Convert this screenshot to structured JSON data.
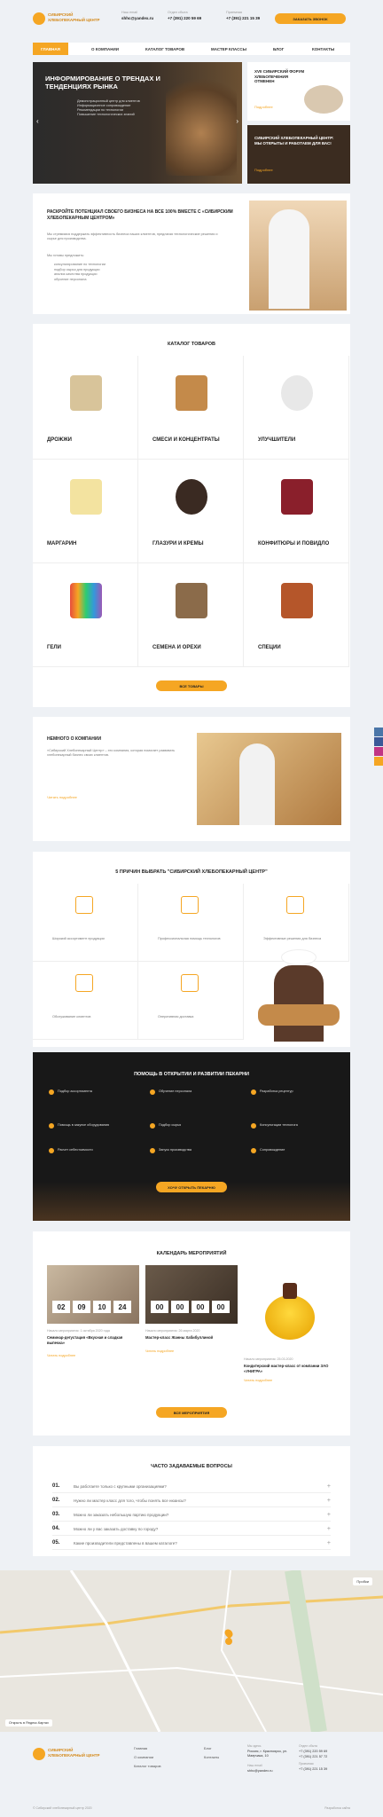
{
  "header": {
    "logo_text": "СИБИРСКИЙ ХЛЕБОПЕКАРНЫЙ ЦЕНТР",
    "email_label": "Наш email",
    "email": "shhc@yandex.ru",
    "sales_label": "Отдел сбыта",
    "sales_phone": "+7 (391) 220 59 69",
    "phone2_label": "Приемная",
    "phone2": "+7 (391) 221 15 39",
    "callback": "ЗАКАЗАТЬ ЗВОНОК"
  },
  "nav": [
    "ГЛАВНАЯ",
    "О КОМПАНИИ",
    "КАТАЛОГ ТОВАРОВ",
    "МАСТЕР КЛАССЫ",
    "БЛОГ",
    "КОНТАКТЫ"
  ],
  "hero": {
    "title": "ИНФОРМИРОВАНИЕ О ТРЕНДАХ И ТЕНДЕНЦИЯХ РЫНКА",
    "bullets": [
      "Демонстрационный центр для клиентов",
      "Информационное сопровождение",
      "Рекомендации по технологии",
      "Повышение технологических знаний"
    ],
    "side1_title": "XVII СИБИРСКИЙ ФОРУМ ХЛЕБОПЕЧЕНИЯ ОТМЕНЕН",
    "side1_link": "Подробнее",
    "side2_title": "СИБИРСКИЙ ХЛЕБОПЕКАРНЫЙ ЦЕНТР: МЫ ОТКРЫТЫ И РАБОТАЕМ ДЛЯ ВАС!",
    "side2_link": "Подробнее"
  },
  "promo": {
    "title": "РАСКРОЙТЕ ПОТЕНЦИАЛ СВОЕГО БИЗНЕСА НА ВСЕ 100% ВМЕСТЕ С «СИБИРСКИМ ХЛЕБОПЕКАРНЫМ ЦЕНТРОМ»",
    "p1": "Мы стремимся поддержать эффективность бизнеса наших клиентов, предлагая технологические решения и сырье для производства.",
    "p2": "Мы готовы предложить:",
    "items": [
      "консультирование по технологии",
      "подбор сырья для продукции",
      "анализ качества продукции",
      "обучение персонала"
    ]
  },
  "catalog": {
    "title": "КАТАЛОГ ТОВАРОВ",
    "items": [
      "ДРОЖЖИ",
      "СМЕСИ И КОНЦЕНТРАТЫ",
      "УЛУЧШИТЕЛИ",
      "МАРГАРИН",
      "ГЛАЗУРИ И КРЕМЫ",
      "КОНФИТЮРЫ И ПОВИДЛО",
      "ГЕЛИ",
      "СЕМЕНА И ОРЕХИ",
      "СПЕЦИИ"
    ],
    "button": "ВСЕ ТОВАРЫ"
  },
  "about": {
    "title": "НЕМНОГО О КОМПАНИИ",
    "text": "«Сибирский Хлебопекарный Центр» – это компания, которая помогает развивать хлебопекарный бизнес своих клиентов.",
    "link": "Читать подробнее"
  },
  "reasons": {
    "title": "5 ПРИЧИН ВЫБРАТЬ \"СИБИРСКИЙ ХЛЕБОПЕКАРНЫЙ ЦЕНТР\"",
    "items": [
      "Широкий ассортимент продукции",
      "Профессиональная помощь технологов",
      "Эффективные решения для бизнеса",
      "Обслуживание клиентов",
      "Оперативная доставка"
    ]
  },
  "help": {
    "title": "ПОМОЩЬ В ОТКРЫТИИ И РАЗВИТИИ ПЕКАРНИ",
    "points": [
      "Подбор ассортимента",
      "Обучение персонала",
      "Разработка рецептур",
      "Помощь в закупке оборудования",
      "Подбор сырья",
      "Консультации технолога",
      "Расчет себестоимости",
      "Запуск производства",
      "Сопровождение"
    ],
    "button": "ХОЧУ ОТКРЫТЬ ПЕКАРНЮ"
  },
  "events": {
    "title": "КАЛЕНДАРЬ МЕРОПРИЯТИЙ",
    "timer1": [
      "02",
      "09",
      "10",
      "24"
    ],
    "timer2": [
      "00",
      "00",
      "00",
      "00"
    ],
    "e1_date": "Начало мероприятия: 1 октября 2020 года",
    "e1_title": "Семинар-дегустация «Вкусная и сладкая выпечка»",
    "e1_link": "Читать подробнее",
    "e2_date": "Начало мероприятия: 26 марта 2020",
    "e2_title": "Мастер-класс Жанны Хабибуллиной",
    "e2_link": "Читать подробнее",
    "e3_date": "Начало мероприятия: 25.03.2020",
    "e3_title": "Кондитерский мастер-класс от компании ЗАО «УНИГРА»",
    "e3_link": "Читать подробнее",
    "button": "ВСЕ МЕРОПРИЯТИЯ"
  },
  "faq": {
    "title": "ЧАСТО ЗАДАВАЕМЫЕ ВОПРОСЫ",
    "items": [
      {
        "n": "01.",
        "q": "Вы работаете только с крупными организациями?"
      },
      {
        "n": "02.",
        "q": "Нужно ли мастер класс для того, чтобы понять все нюансы?"
      },
      {
        "n": "03.",
        "q": "Можно ли заказать небольшую партию продукции?"
      },
      {
        "n": "04.",
        "q": "Можно ли у вас заказать доставку по городу?"
      },
      {
        "n": "05.",
        "q": "Какие производители представлены в вашем каталоге?"
      }
    ]
  },
  "map": {
    "label1": "Пробки",
    "label2": "Открыть в Яндекс.Картах"
  },
  "footer": {
    "links1": [
      "Главная",
      "О компании",
      "Каталог товаров"
    ],
    "links2": [
      "Блог",
      "Контакты"
    ],
    "addr_label": "Мы здесь",
    "addr": "Россия, г. Красноярск, ул. Маерчака, 10",
    "sales_label": "Отдел сбыта",
    "sales_phone": "+7 (391) 220 59 69",
    "sales_phone2": "+7 (391) 221 57 72",
    "email_label": "Наш email",
    "email": "shhc@yandex.ru",
    "reception_label": "Приемная",
    "reception_phone": "+7 (391) 221 15 39",
    "copyright": "© Сибирский хлебопекарный центр 2020",
    "dev": "Разработка сайта"
  },
  "colors": {
    "accent": "#f5a623",
    "dark": "#1c1c1c"
  }
}
